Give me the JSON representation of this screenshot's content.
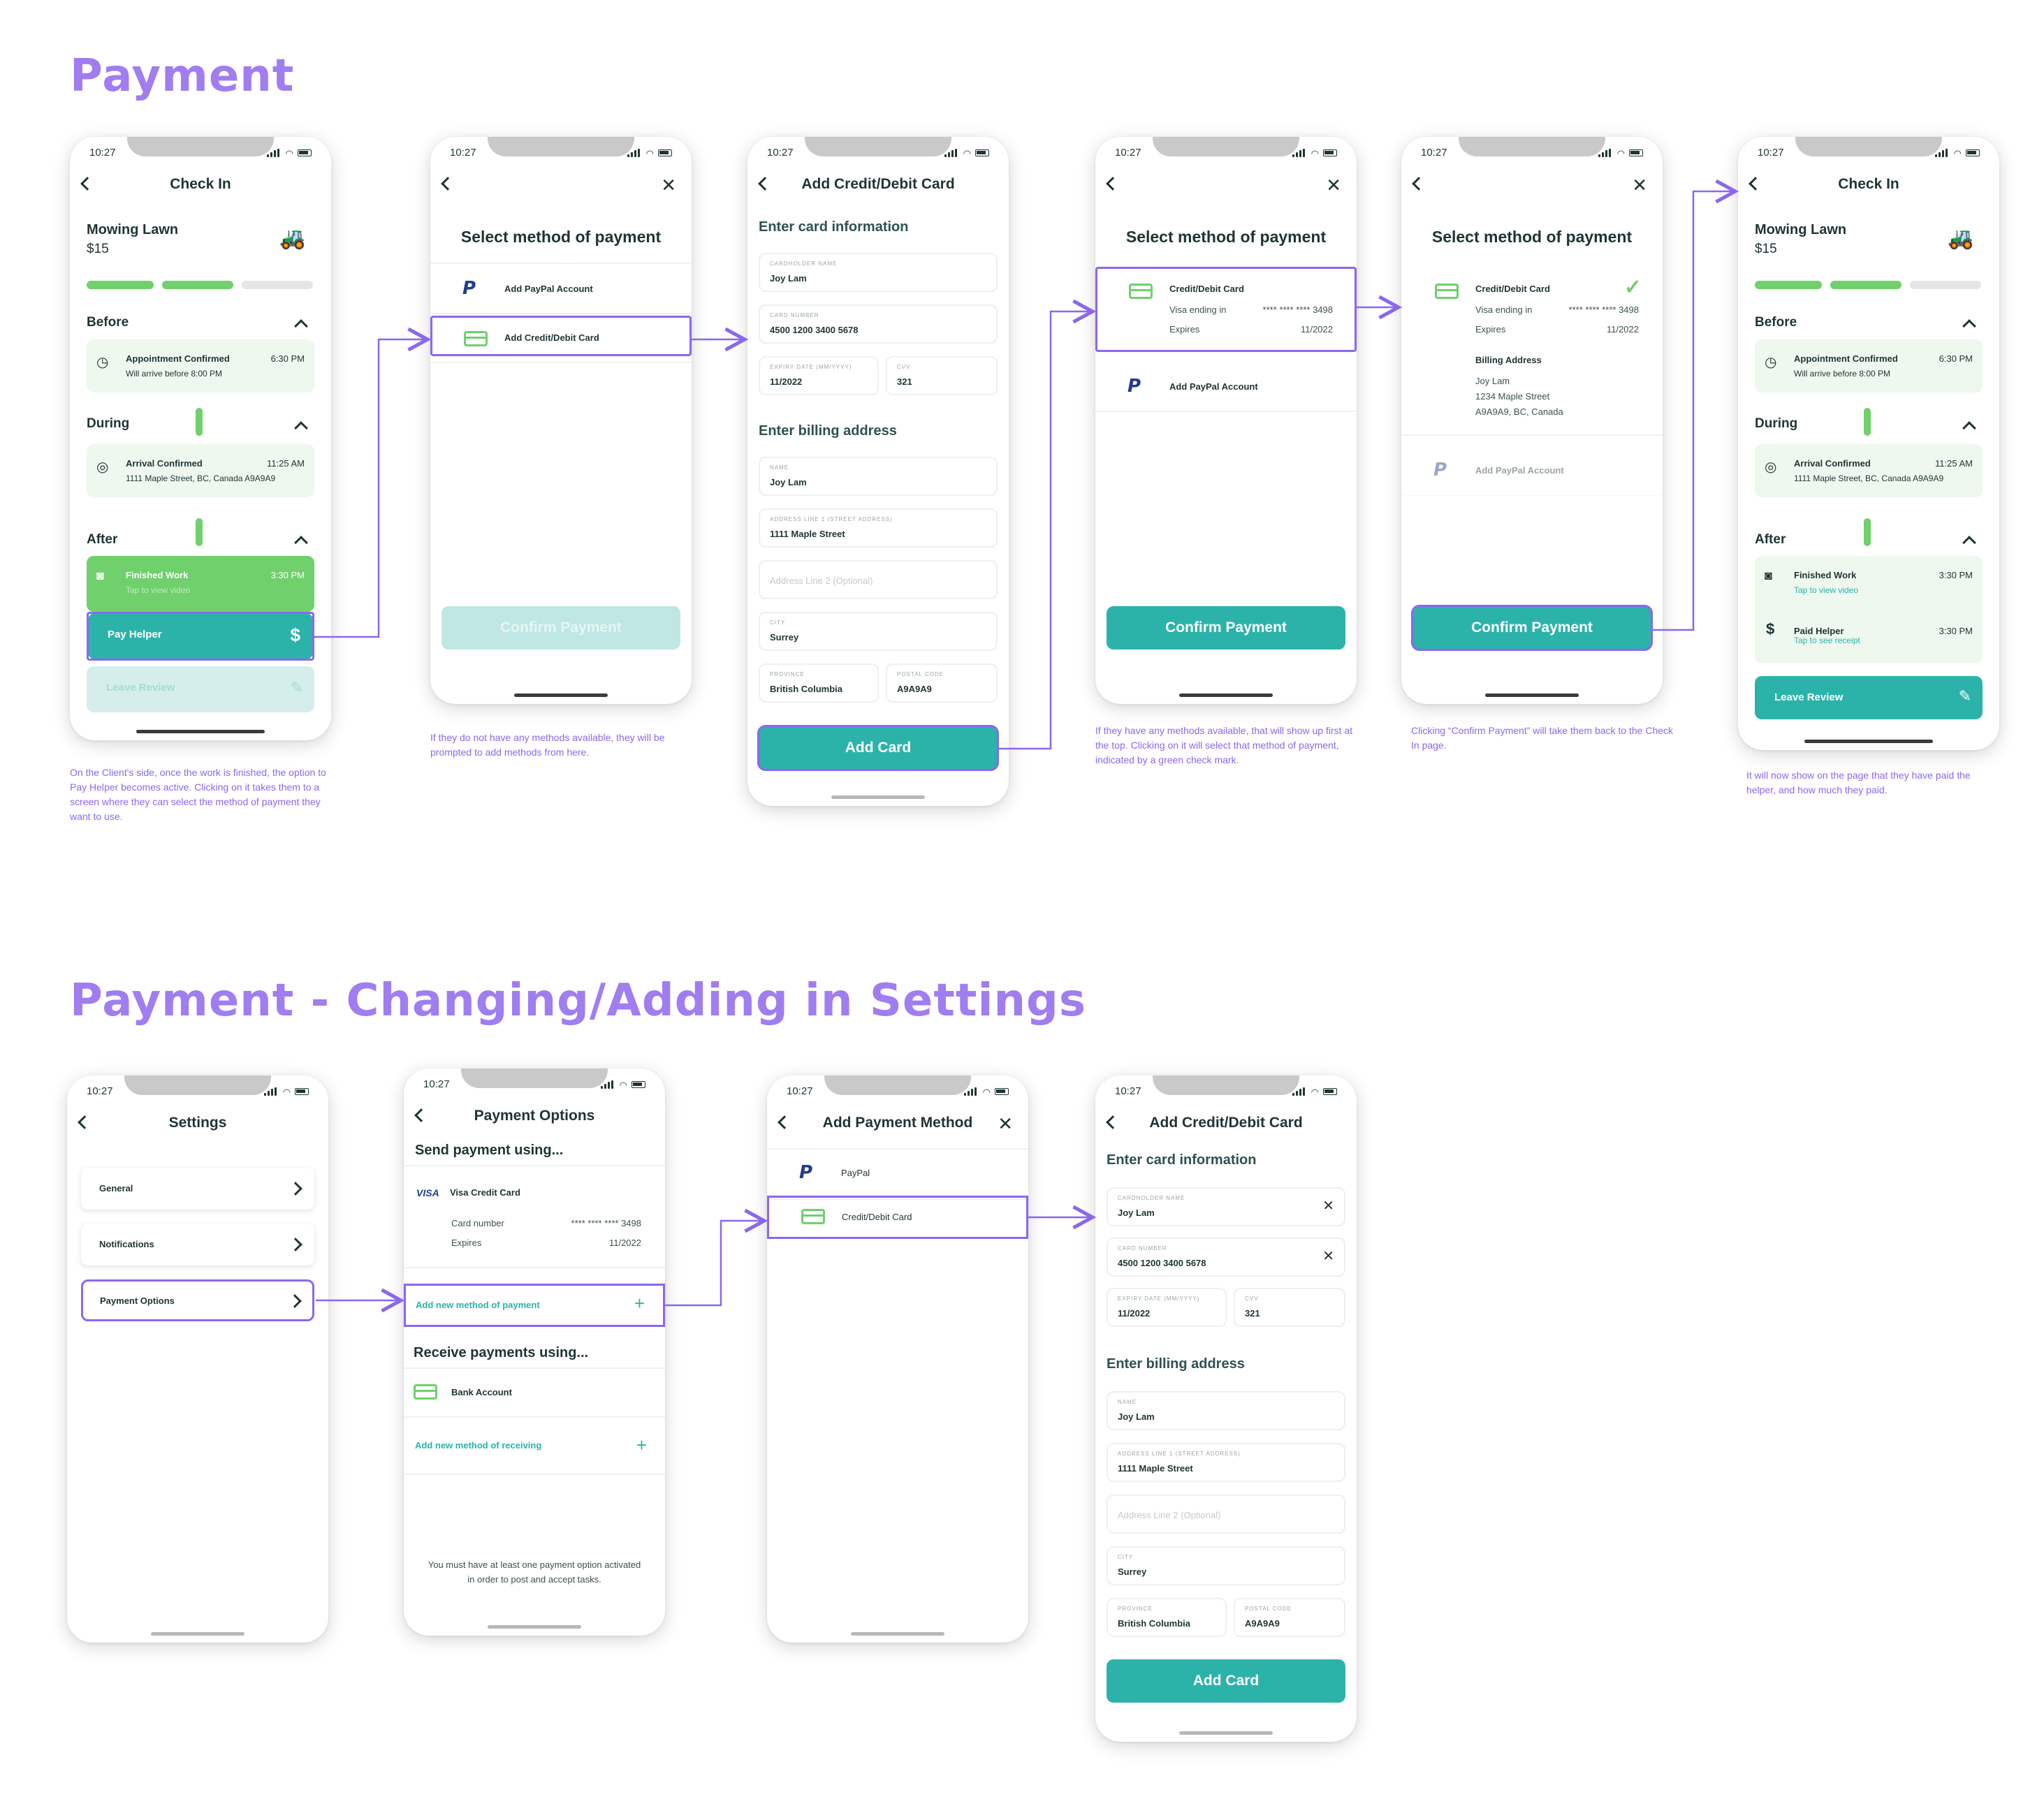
{
  "titles": {
    "payment": "Payment",
    "settings": "Payment - Changing/Adding in Settings"
  },
  "colors": {
    "accent": "#8b67f0",
    "teal": "#2bb3aa",
    "green": "#6fd06c",
    "disabled": "#bfe7e3"
  },
  "status": {
    "time": "10:27"
  },
  "checkin": {
    "title": "Check In",
    "job": "Mowing Lawn",
    "price": "$15",
    "before": "Before",
    "during": "During",
    "after": "After",
    "appt": "Appointment Confirmed",
    "appt_time": "6:30 PM",
    "appt_sub": "Will arrive before 8:00 PM",
    "arrival": "Arrival Confirmed",
    "arrival_time": "11:25 AM",
    "arrival_sub": "1111 Maple Street, BC, Canada A9A9A9",
    "finished": "Finished Work",
    "finished_time": "3:30 PM",
    "finished_sub": "Tap to view video",
    "pay_helper": "Pay Helper",
    "leave_review": "Leave Review",
    "paid": "Paid Helper",
    "paid_time": "3:30 PM",
    "paid_sub": "Tap to see receipt"
  },
  "select": {
    "title": "Select method of payment",
    "paypal": "Add PayPal Account",
    "card": "Add Credit/Debit Card",
    "confirm": "Confirm Payment",
    "card_title": "Credit/Debit Card",
    "visa_ending": "Visa ending in",
    "masked": "**** **** **** 3498",
    "expires": "Expires",
    "exp_val": "11/2022",
    "billing": "Billing Address",
    "billing_lines": [
      "Joy Lam",
      "1234 Maple Street",
      "A9A9A9, BC, Canada"
    ]
  },
  "addcard": {
    "title": "Add Credit/Debit Card",
    "card_info": "Enter card information",
    "billing": "Enter billing address",
    "l_name": "CARDHOLDER NAME",
    "v_name": "Joy Lam",
    "l_num": "CARD NUMBER",
    "v_num": "4500 1200 3400 5678",
    "l_exp": "EXPIRY DATE (MM/YYYY)",
    "v_exp": "11/2022",
    "l_cvv": "CVV",
    "v_cvv": "321",
    "l_bname": "NAME",
    "v_bname": "Joy Lam",
    "l_addr": "ADDRESS LINE 1 (STREET ADDRESS)",
    "v_addr": "1111 Maple Street",
    "p_addr2": "Address Line 2 (Optional)",
    "l_city": "CITY",
    "v_city": "Surrey",
    "l_prov": "PROVINCE",
    "v_prov": "British Columbia",
    "l_post": "POSTAL CODE",
    "v_post": "A9A9A9",
    "add": "Add Card"
  },
  "notes": {
    "n1": "On the Client's side, once the work is finished, the option to Pay Helper becomes active. Clicking on it takes them to a screen where they can select the method of payment they want to use.",
    "n2": "If they do not have any methods available, they will be prompted to add methods from here.",
    "n3": "If they have any methods available, that will show up first at the top. Clicking on it will select that method of payment, indicated by a green check mark.",
    "n4": "Clicking “Confirm Payment” will take them back to the Check In page.",
    "n5": "It will now show on the page that they have paid the helper, and how much they paid."
  },
  "settings": {
    "title": "Settings",
    "general": "General",
    "notifications": "Notifications",
    "payment_options": "Payment Options"
  },
  "payopts": {
    "title": "Payment Options",
    "send": "Send payment using...",
    "visa_logo": "VISA",
    "visa": "Visa Credit Card",
    "card_number": "Card number",
    "masked": "**** **** **** 3498",
    "expires": "Expires",
    "exp_val": "11/2022",
    "add_pay": "Add new method of payment",
    "receive": "Receive payments using...",
    "bank": "Bank Account",
    "add_recv": "Add new method of receiving",
    "footnote": "You must have at least one payment option activated in order to post and accept tasks."
  },
  "addmethod": {
    "title": "Add Payment Method",
    "paypal": "PayPal",
    "card": "Credit/Debit Card"
  }
}
